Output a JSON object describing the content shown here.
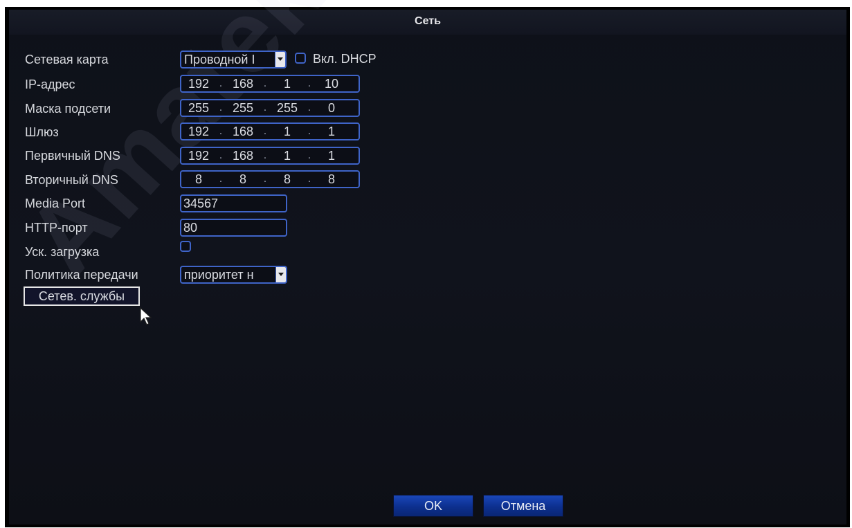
{
  "window": {
    "title": "Сеть"
  },
  "watermark": "Amatek",
  "fields": {
    "network_card": {
      "label": "Сетевая карта",
      "value": "Проводной I",
      "dhcp_label": "Вкл. DHCP"
    },
    "ip": {
      "label": "IP-адрес",
      "octets": [
        "192",
        "168",
        "1",
        "10"
      ]
    },
    "mask": {
      "label": "Маска подсети",
      "octets": [
        "255",
        "255",
        "255",
        "0"
      ]
    },
    "gateway": {
      "label": "Шлюз",
      "octets": [
        "192",
        "168",
        "1",
        "1"
      ]
    },
    "dns1": {
      "label": "Первичный DNS",
      "octets": [
        "192",
        "168",
        "1",
        "1"
      ]
    },
    "dns2": {
      "label": "Вторичный DNS",
      "octets": [
        "8",
        "8",
        "8",
        "8"
      ]
    },
    "media_port": {
      "label": "Media Port",
      "value": "34567"
    },
    "http_port": {
      "label": "HTTP-порт",
      "value": "80"
    },
    "fast_download": {
      "label": "Уск. загрузка"
    },
    "transfer_policy": {
      "label": "Политика передачи",
      "value": "приоритет н"
    }
  },
  "buttons": {
    "services": "Сетев. службы",
    "ok": "OK",
    "cancel": "Отмена"
  },
  "colors": {
    "accent_border": "#3f64c8",
    "button_blue": "#1a47b8",
    "background": "#10131c"
  }
}
